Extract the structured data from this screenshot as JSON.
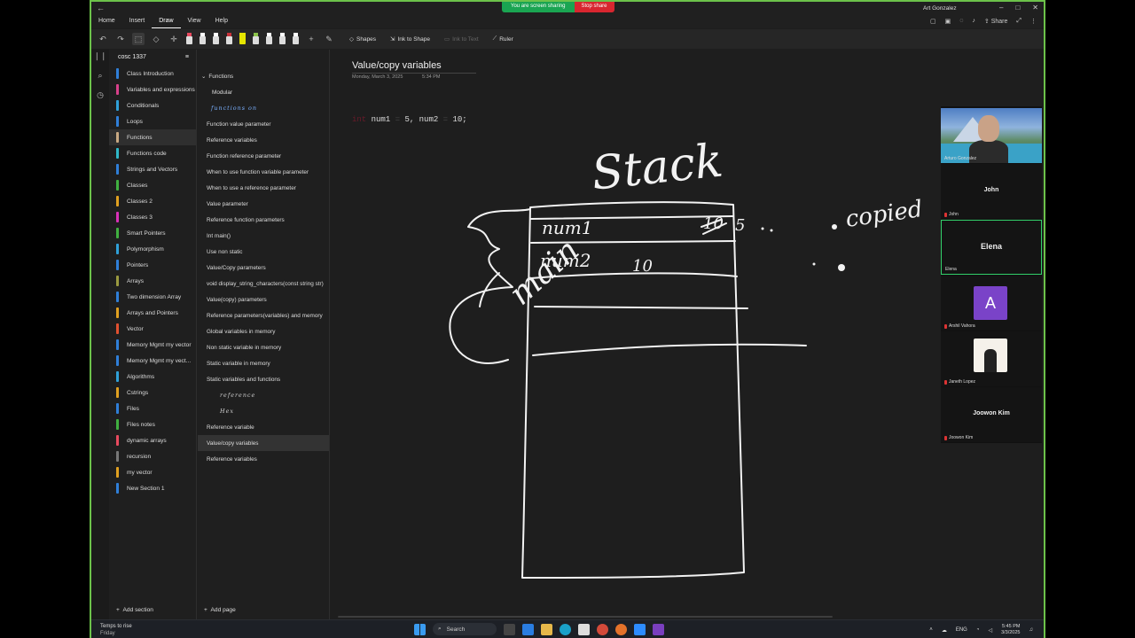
{
  "titlebar": {
    "sharing_msg": "You are screen sharing",
    "stop_share": "Stop share",
    "user": "Art Gonzalez"
  },
  "menu": [
    "Home",
    "Insert",
    "Draw",
    "View",
    "Help"
  ],
  "menu_active": "Draw",
  "share_label": "Share",
  "toolbar": {
    "shapes": "Shapes",
    "ink_to_shape": "Ink to Shape",
    "ink_to_text": "Ink to Text",
    "ruler": "Ruler",
    "pen_colors": [
      "#e84a5f",
      "#ffffff",
      "#ffffff",
      "#e6e600",
      "#8bc34a",
      "#ffffff",
      "#ffffff",
      "#ffffff",
      "#ffffff"
    ]
  },
  "notebook": {
    "name": "cosc 1337"
  },
  "sections": [
    {
      "label": "Class Introduction",
      "color": "#2f7fd8"
    },
    {
      "label": "Variables and expressions",
      "color": "#d8408a"
    },
    {
      "label": "Conditionals",
      "color": "#2fa0d8"
    },
    {
      "label": "Loops",
      "color": "#2f7fd8"
    },
    {
      "label": "Functions",
      "color": "#c8a882",
      "selected": true
    },
    {
      "label": "Functions code",
      "color": "#2fb8c8"
    },
    {
      "label": "Strings and Vectors",
      "color": "#2f7fd8"
    },
    {
      "label": "Classes",
      "color": "#40b040"
    },
    {
      "label": "Classes 2",
      "color": "#e0a020"
    },
    {
      "label": "Classes 3",
      "color": "#d830b8"
    },
    {
      "label": "Smart Pointers",
      "color": "#40b040"
    },
    {
      "label": "Polymorphism",
      "color": "#2fa0d8"
    },
    {
      "label": "Pointers",
      "color": "#2f7fd8"
    },
    {
      "label": "Arrays",
      "color": "#9a9a40"
    },
    {
      "label": "Two dimension Array",
      "color": "#2f7fd8"
    },
    {
      "label": "Arrays and Pointers",
      "color": "#e0a020"
    },
    {
      "label": "Vector",
      "color": "#e05030"
    },
    {
      "label": "Memory Mgmt my vector",
      "color": "#2f7fd8"
    },
    {
      "label": "Memory Mgmt my vect...",
      "color": "#2f7fd8"
    },
    {
      "label": "Algorithms",
      "color": "#2fa0d8"
    },
    {
      "label": "Cstrings",
      "color": "#e0a020"
    },
    {
      "label": "Files",
      "color": "#2f7fd8"
    },
    {
      "label": "Files notes",
      "color": "#40b040"
    },
    {
      "label": "dynamic arrays",
      "color": "#e84a5f"
    },
    {
      "label": "recursion",
      "color": "#777777"
    },
    {
      "label": "my vector",
      "color": "#e0a020"
    },
    {
      "label": "New Section 1",
      "color": "#2f7fd8"
    }
  ],
  "add_section": "Add section",
  "pages": [
    {
      "label": "Functions",
      "type": "header"
    },
    {
      "label": "Modular",
      "type": "sub"
    },
    {
      "label": "functions on",
      "type": "ink-blue"
    },
    {
      "label": "Function value parameter",
      "type": "normal"
    },
    {
      "label": "Reference variables",
      "type": "normal"
    },
    {
      "label": "Function reference parameter",
      "type": "normal"
    },
    {
      "label": "When to use function variable parameter",
      "type": "normal"
    },
    {
      "label": "When to use a reference parameter",
      "type": "normal"
    },
    {
      "label": "Value parameter",
      "type": "normal"
    },
    {
      "label": "Reference function parameters",
      "type": "normal"
    },
    {
      "label": "Int main()",
      "type": "normal"
    },
    {
      "label": "Use non static",
      "type": "normal"
    },
    {
      "label": "Value/Copy parameters",
      "type": "normal"
    },
    {
      "label": "void display_string_characters(const string str)",
      "type": "normal"
    },
    {
      "label": "Value(copy) parameters",
      "type": "normal"
    },
    {
      "label": "Reference parameters(variables) and memory",
      "type": "normal"
    },
    {
      "label": "Global variables in memory",
      "type": "normal"
    },
    {
      "label": "Non static variable in memory",
      "type": "normal"
    },
    {
      "label": "Static variable in memory",
      "type": "normal"
    },
    {
      "label": "Static variables and functions",
      "type": "normal"
    },
    {
      "label": "reference",
      "type": "ink"
    },
    {
      "label": "Hex",
      "type": "ink"
    },
    {
      "label": "Reference variable",
      "type": "normal"
    },
    {
      "label": "Value/copy variables",
      "type": "normal",
      "selected": true
    },
    {
      "label": "Reference variables",
      "type": "normal"
    }
  ],
  "add_page": "Add page",
  "page": {
    "title": "Value/copy variables",
    "date": "Monday, March 3, 2025",
    "time": "5:34 PM",
    "code_kw": "int",
    "code_a": "num1",
    "code_eq1": "=",
    "code_v1": "5,",
    "code_b": "num2",
    "code_eq2": "=",
    "code_v2": "10;"
  },
  "ink": {
    "stack": "Stack",
    "main": "main",
    "num1": "num1",
    "num2": "num2",
    "val1": "10",
    "val1_new": "5",
    "val2": "10",
    "copied": "copied"
  },
  "participants": [
    {
      "name": "Arturo Gonzalez",
      "kind": "video"
    },
    {
      "name": "John",
      "kind": "name"
    },
    {
      "name": "Elena",
      "kind": "name",
      "highlight": true
    },
    {
      "name": "Arshil Vahora",
      "kind": "avatar",
      "initial": "A"
    },
    {
      "name": "Janeth Lopez",
      "kind": "photo"
    },
    {
      "name": "Joowon Kim",
      "kind": "name"
    }
  ],
  "taskbar": {
    "weather_title": "Temps to rise",
    "weather_sub": "Friday",
    "search": "Search",
    "lang": "ENG",
    "time": "5:45 PM",
    "date": "3/3/2025"
  }
}
